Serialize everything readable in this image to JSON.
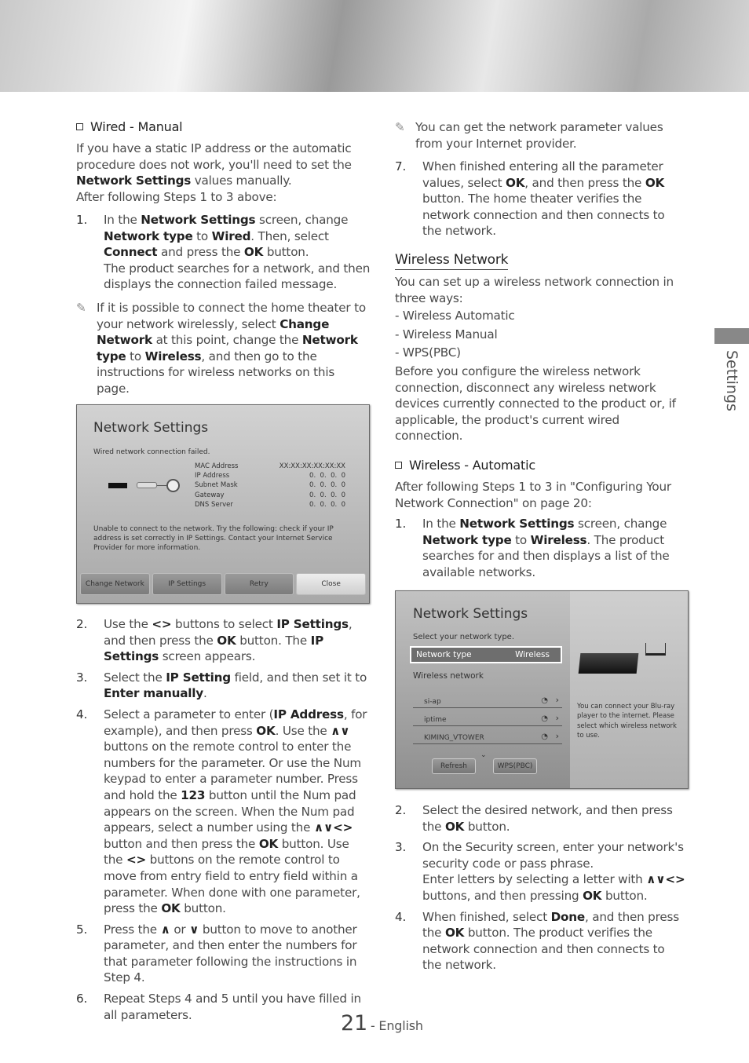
{
  "side_tab": "Settings",
  "footer": {
    "page": "21",
    "suffix": "- English"
  },
  "left": {
    "section": "Wired - Manual",
    "intro": [
      "If you have a static IP address or the automatic procedure does not work, you'll need to set the ",
      {
        "b": "Network Settings"
      },
      " values manually."
    ],
    "after": "After following Steps 1 to 3 above:",
    "step1": {
      "num": "1.",
      "text": [
        "In the ",
        {
          "b": "Network Settings"
        },
        " screen, change ",
        {
          "b": "Network type"
        },
        " to ",
        {
          "b": "Wired"
        },
        ". Then, select ",
        {
          "b": "Connect"
        },
        " and press the ",
        {
          "b": "OK"
        },
        " button."
      ],
      "extra": "The product searches for a network, and then displays the connection failed message."
    },
    "note": [
      "If it is possible to connect the home theater to your network wirelessly, select ",
      {
        "b": "Change Network"
      },
      " at this point, change the ",
      {
        "b": "Network type"
      },
      " to ",
      {
        "b": "Wireless"
      },
      ", and then go to the instructions for wireless networks on this page."
    ],
    "steps": [
      {
        "num": "2.",
        "text": [
          "Use the ",
          {
            "b": "<>"
          },
          " buttons to select ",
          {
            "b": "IP Settings"
          },
          ", and then press the ",
          {
            "b": "OK"
          },
          " button. The ",
          {
            "b": "IP Settings"
          },
          " screen appears."
        ]
      },
      {
        "num": "3.",
        "text": [
          "Select the ",
          {
            "b": "IP Setting"
          },
          " field, and then set it to ",
          {
            "b": "Enter manually"
          },
          "."
        ]
      },
      {
        "num": "4.",
        "text": [
          "Select a parameter to enter (",
          {
            "b": "IP Address"
          },
          ", for example), and then press ",
          {
            "b": "OK"
          },
          ". Use the ",
          {
            "b": "∧∨"
          },
          " buttons on the remote control to enter the numbers for the parameter. Or use the Num keypad to enter a parameter number. Press and hold the ",
          {
            "b": "123"
          },
          " button until the Num pad appears on the screen. When the Num pad appears, select a number using the ",
          {
            "b": "∧∨<>"
          },
          " button and then press the ",
          {
            "b": "OK"
          },
          " button. Use the ",
          {
            "b": "<>"
          },
          " buttons on the remote control to move from entry field to entry field within a parameter. When done with one parameter, press the ",
          {
            "b": "OK"
          },
          " button."
        ]
      },
      {
        "num": "5.",
        "text": [
          "Press the ",
          {
            "b": "∧"
          },
          " or ",
          {
            "b": "∨"
          },
          " button to move to another parameter, and then enter the numbers for that parameter following the instructions in Step 4."
        ]
      },
      {
        "num": "6.",
        "text": [
          "Repeat Steps 4 and 5 until you have filled in all parameters."
        ]
      }
    ]
  },
  "screen1": {
    "title": "Network Settings",
    "status": "Wired network connection failed.",
    "fields": [
      {
        "label": "MAC Address",
        "value": "XX:XX:XX:XX:XX:XX"
      },
      {
        "label": "IP Address",
        "value": "0.  0.  0.  0"
      },
      {
        "label": "Subnet Mask",
        "value": "0.  0.  0.  0"
      },
      {
        "label": "Gateway",
        "value": "0.  0.  0.  0"
      },
      {
        "label": "DNS Server",
        "value": "0.  0.  0.  0"
      }
    ],
    "message": "Unable to connect to the network. Try the following: check if your IP address is set correctly in IP Settings. Contact your Internet Service Provider for more information.",
    "buttons": [
      "Change Network",
      "IP Settings",
      "Retry",
      "Close"
    ]
  },
  "right": {
    "note": "You can get the network parameter values from your Internet provider.",
    "step7": {
      "num": "7.",
      "text": [
        "When finished entering all the parameter values, select ",
        {
          "b": "OK"
        },
        ", and then press the ",
        {
          "b": "OK"
        },
        " button. The home theater verifies the network connection and then connects to the network."
      ]
    },
    "heading": "Wireless Network",
    "intro": "You can set up a wireless network connection in three ways:",
    "ways": [
      "Wireless Automatic",
      "Wireless Manual",
      "WPS(PBC)"
    ],
    "before": "Before you configure the wireless network connection, disconnect any wireless network devices currently connected to the product or, if applicable, the product's current wired connection.",
    "section": "Wireless - Automatic",
    "after": "After following Steps 1 to 3 in \"Configuring Your Network Connection\" on page 20:",
    "step1": {
      "num": "1.",
      "text": [
        "In the ",
        {
          "b": "Network Settings"
        },
        " screen, change ",
        {
          "b": "Network type"
        },
        " to ",
        {
          "b": "Wireless"
        },
        ". The product searches for and then displays a list of the available networks."
      ]
    },
    "steps": [
      {
        "num": "2.",
        "text": [
          "Select the desired network, and then press the ",
          {
            "b": "OK"
          },
          " button."
        ]
      },
      {
        "num": "3.",
        "text": [
          "On the Security screen, enter your network's security code or pass phrase."
        ],
        "extra": [
          "Enter letters by selecting a letter with ",
          {
            "b": "∧∨<>"
          },
          " buttons, and then pressing ",
          {
            "b": "OK"
          },
          " button."
        ]
      },
      {
        "num": "4.",
        "text": [
          "When finished, select ",
          {
            "b": "Done"
          },
          ", and then press the ",
          {
            "b": "OK"
          },
          " button. The product verifies the network connection and then connects to the network."
        ]
      }
    ]
  },
  "screen2": {
    "title": "Network Settings",
    "prompt": "Select your network type.",
    "type_label": "Network type",
    "type_value": "Wireless",
    "list_label": "Wireless network",
    "networks": [
      "si-ap",
      "iptime",
      "KIMING_VTOWER"
    ],
    "buttons": [
      "Refresh",
      "WPS(PBC)"
    ],
    "help": "You can connect your Blu-ray player to the internet. Please select which wireless network to use."
  }
}
